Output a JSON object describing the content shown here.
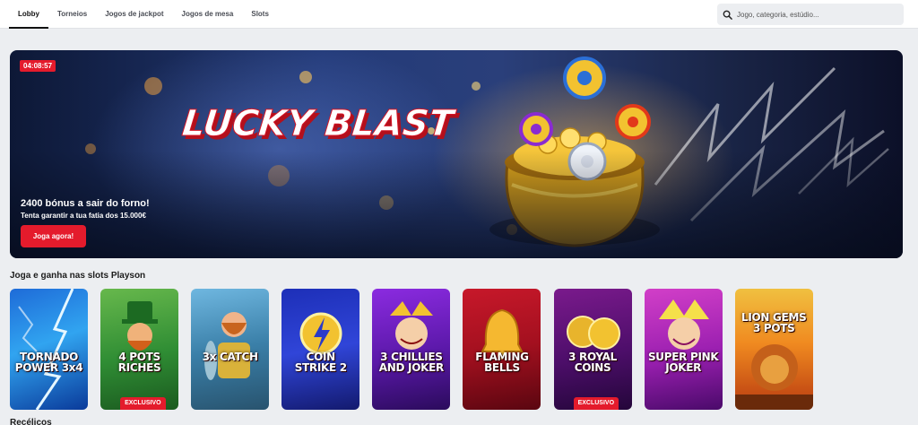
{
  "nav": {
    "tabs": [
      {
        "label": "Lobby",
        "active": true
      },
      {
        "label": "Torneios",
        "active": false
      },
      {
        "label": "Jogos de jackpot",
        "active": false
      },
      {
        "label": "Jogos de mesa",
        "active": false
      },
      {
        "label": "Slots",
        "active": false
      }
    ],
    "search": {
      "placeholder": "Jogo, categoria, estúdio...",
      "value": "",
      "icon": "search-icon"
    }
  },
  "hero": {
    "timer": "04:08:57",
    "logo_text": "LUCKY BLAST",
    "title": "2400 bónus a sair do forno!",
    "subtitle": "Tenta garantir a tua fatia dos 15.000€",
    "cta_label": "Joga agora!",
    "accent_color": "#e41b2c"
  },
  "section": {
    "title": "Joga e ganha nas slots Playson",
    "games": [
      {
        "name": "TORNADO POWER 3x4",
        "badge": ""
      },
      {
        "name": "4 POTS RICHES",
        "badge": "EXCLUSIVO"
      },
      {
        "name": "3x CATCH",
        "badge": ""
      },
      {
        "name": "COIN STRIKE 2",
        "badge": ""
      },
      {
        "name": "3 CHILLIES AND JOKER",
        "badge": ""
      },
      {
        "name": "FLAMING BELLS",
        "badge": ""
      },
      {
        "name": "3 ROYAL COINS",
        "badge": "EXCLUSIVO"
      },
      {
        "name": "SUPER PINK JOKER",
        "badge": ""
      },
      {
        "name": "LION GEMS 3 POTS",
        "badge": ""
      }
    ]
  },
  "next_section": {
    "title": "Recélicos"
  }
}
